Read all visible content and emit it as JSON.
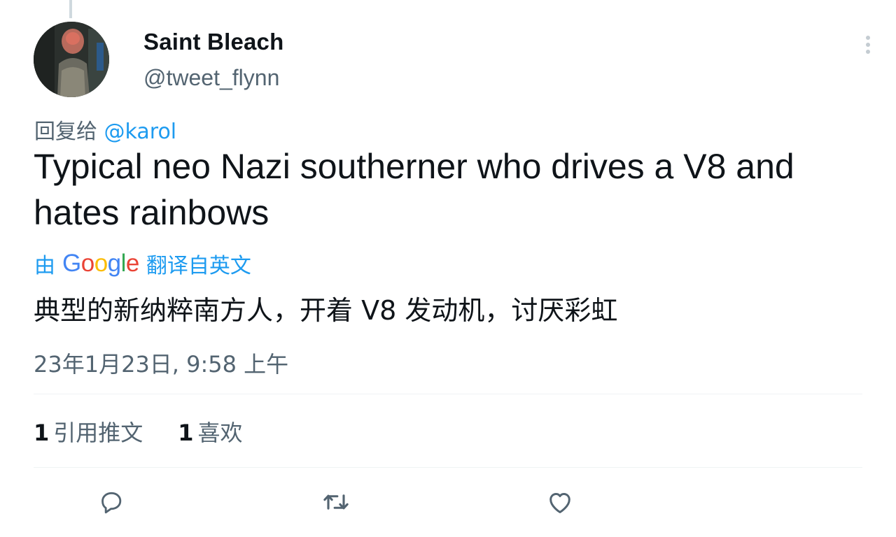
{
  "author": {
    "name": "Saint Bleach",
    "handle": "@tweet_flynn"
  },
  "reply": {
    "prefix": "回复给",
    "mention": "@karol"
  },
  "tweet": {
    "text": "Typical neo Nazi southerner who drives a V8 and hates rainbows"
  },
  "translation": {
    "by": "由",
    "provider": "Google",
    "suffix": "翻译自英文",
    "text": "典型的新纳粹南方人，开着 V8 发动机，讨厌彩虹"
  },
  "timestamp": "23年1月23日, 9:58 上午",
  "stats": {
    "quotes_count": "1",
    "quotes_label": "引用推文",
    "likes_count": "1",
    "likes_label": "喜欢"
  },
  "actions": [
    "reply-icon",
    "retweet-icon",
    "like-icon"
  ],
  "colors": {
    "link": "#1d9bf0",
    "secondary_text": "#536471",
    "primary_text": "#0f1419"
  }
}
